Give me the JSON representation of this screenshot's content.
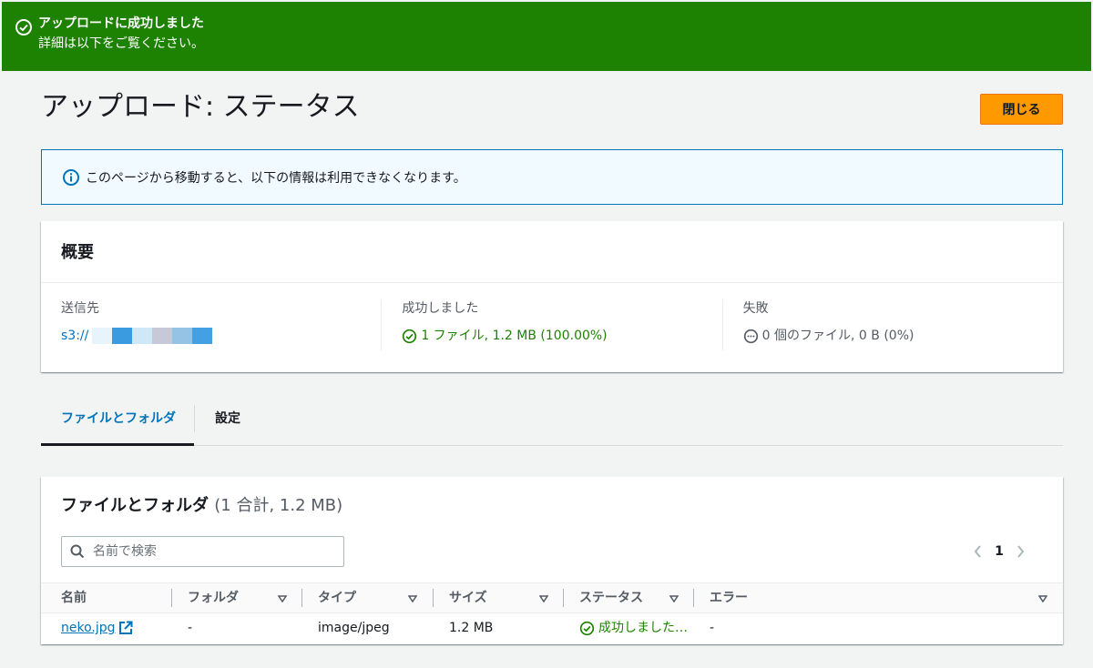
{
  "flash": {
    "title": "アップロードに成功しました",
    "subtitle": "詳細は以下をご覧ください。",
    "color": "#1d8102"
  },
  "page": {
    "title": "アップロード: ステータス",
    "close_label": "閉じる"
  },
  "info": {
    "message": "このページから移動すると、以下の情報は利用できなくなります。"
  },
  "summary": {
    "heading": "概要",
    "destination": {
      "label": "送信先",
      "value": "s3://"
    },
    "succeeded": {
      "label": "成功しました",
      "value": "1 ファイル, 1.2 MB (100.00%)"
    },
    "failed": {
      "label": "失敗",
      "value": "0 個のファイル, 0 B (0%)"
    }
  },
  "tabs": [
    {
      "label": "ファイルとフォルダ",
      "active": true
    },
    {
      "label": "設定",
      "active": false
    }
  ],
  "files": {
    "title": "ファイルとフォルダ",
    "count": "(1 合計, 1.2 MB)",
    "search_placeholder": "名前で検索",
    "page": "1",
    "columns": [
      "名前",
      "フォルダ",
      "タイプ",
      "サイズ",
      "ステータス",
      "エラー"
    ],
    "rows": [
      {
        "name": "neko.jpg",
        "folder": "-",
        "type": "image/jpeg",
        "size": "1.2 MB",
        "status": "成功しました…",
        "error": "-"
      }
    ]
  },
  "colors": {
    "accent": "#ff9900",
    "link": "#0073bb",
    "success": "#1d8102",
    "info_bg": "#f1faff"
  }
}
